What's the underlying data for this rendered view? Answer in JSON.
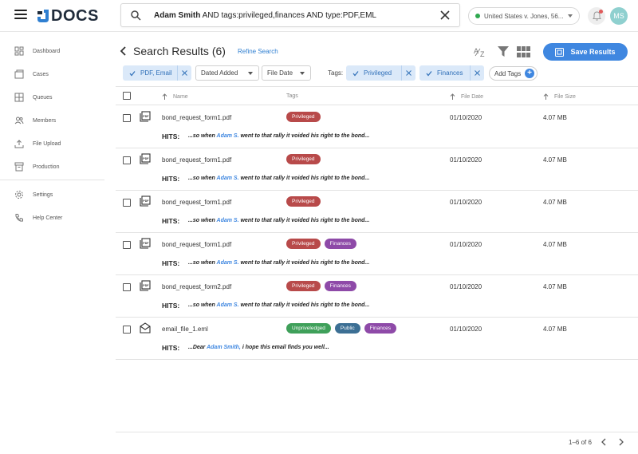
{
  "app": {
    "logo_text": "DOCS"
  },
  "search": {
    "query_bold": "Adam Smith",
    "query_rest": " AND tags:privileged,finances AND type:PDF,EML"
  },
  "case": {
    "label": "United States v. Jones, 56..."
  },
  "user": {
    "initials": "MS"
  },
  "sidebar": {
    "items": [
      {
        "label": "Dashboard",
        "icon": "dashboard-icon"
      },
      {
        "label": "Cases",
        "icon": "cases-icon"
      },
      {
        "label": "Queues",
        "icon": "queues-icon"
      },
      {
        "label": "Members",
        "icon": "members-icon"
      },
      {
        "label": "File Upload",
        "icon": "upload-icon"
      },
      {
        "label": "Production",
        "icon": "archive-icon"
      },
      {
        "label": "Settings",
        "icon": "gear-icon"
      },
      {
        "label": "Help Center",
        "icon": "phone-icon"
      }
    ]
  },
  "header": {
    "title": "Search Results (6)",
    "refine": "Refine Search",
    "save_label": "Save Results"
  },
  "filters": {
    "type_chip": "PDF, Email",
    "dated_added": "Dated Added",
    "file_date": "File Date",
    "tags_label": "Tags:",
    "tag_privileged": "Privileged",
    "tag_finances": "Finances",
    "add_tags": "Add Tags"
  },
  "table": {
    "columns": {
      "name": "Name",
      "tags": "Tags",
      "file_date": "File Date",
      "file_size": "File Size"
    },
    "hits_label": "HITS:",
    "rows": [
      {
        "name": "bond_request_form1.pdf",
        "type": "pdf",
        "tags": [
          {
            "label": "Privileged",
            "color": "#b84a4a"
          }
        ],
        "date": "01/10/2020",
        "size": "4.07 MB",
        "hit_pre": "...so when ",
        "hit_hl": "Adam S.",
        "hit_post": " went to that rally it voided his right to the bond..."
      },
      {
        "name": "bond_request_form1.pdf",
        "type": "pdf",
        "tags": [
          {
            "label": "Privileged",
            "color": "#b84a4a"
          }
        ],
        "date": "01/10/2020",
        "size": "4.07 MB",
        "hit_pre": "...so when ",
        "hit_hl": "Adam S.",
        "hit_post": " went to that rally it voided his right to the bond..."
      },
      {
        "name": "bond_request_form1.pdf",
        "type": "pdf",
        "tags": [
          {
            "label": "Privileged",
            "color": "#b84a4a"
          }
        ],
        "date": "01/10/2020",
        "size": "4.07 MB",
        "hit_pre": "...so when ",
        "hit_hl": "Adam S.",
        "hit_post": " went to that rally it voided his right to the bond..."
      },
      {
        "name": "bond_request_form1.pdf",
        "type": "pdf",
        "tags": [
          {
            "label": "Privileged",
            "color": "#b84a4a"
          },
          {
            "label": "Finances",
            "color": "#8e4aa8"
          }
        ],
        "date": "01/10/2020",
        "size": "4.07 MB",
        "hit_pre": "...so when ",
        "hit_hl": "Adam S.",
        "hit_post": " went to that rally it voided his right to the bond..."
      },
      {
        "name": "bond_request_form2.pdf",
        "type": "pdf",
        "tags": [
          {
            "label": "Privileged",
            "color": "#b84a4a"
          },
          {
            "label": "Finances",
            "color": "#8e4aa8"
          }
        ],
        "date": "01/10/2020",
        "size": "4.07 MB",
        "hit_pre": "...so when ",
        "hit_hl": "Adam S.",
        "hit_post": " went to that rally it voided his right to the bond..."
      },
      {
        "name": "email_file_1.eml",
        "type": "email",
        "tags": [
          {
            "label": "Unpriveledged",
            "color": "#3fa05a"
          },
          {
            "label": "Public",
            "color": "#3c6f94"
          },
          {
            "label": "Finances",
            "color": "#8e4aa8"
          }
        ],
        "date": "01/10/2020",
        "size": "4.07 MB",
        "hit_pre": "...Dear ",
        "hit_hl": "Adam Smith,",
        "hit_post": " i hope this email finds you well..."
      }
    ]
  },
  "pagination": {
    "label": "1–6 of 6"
  }
}
